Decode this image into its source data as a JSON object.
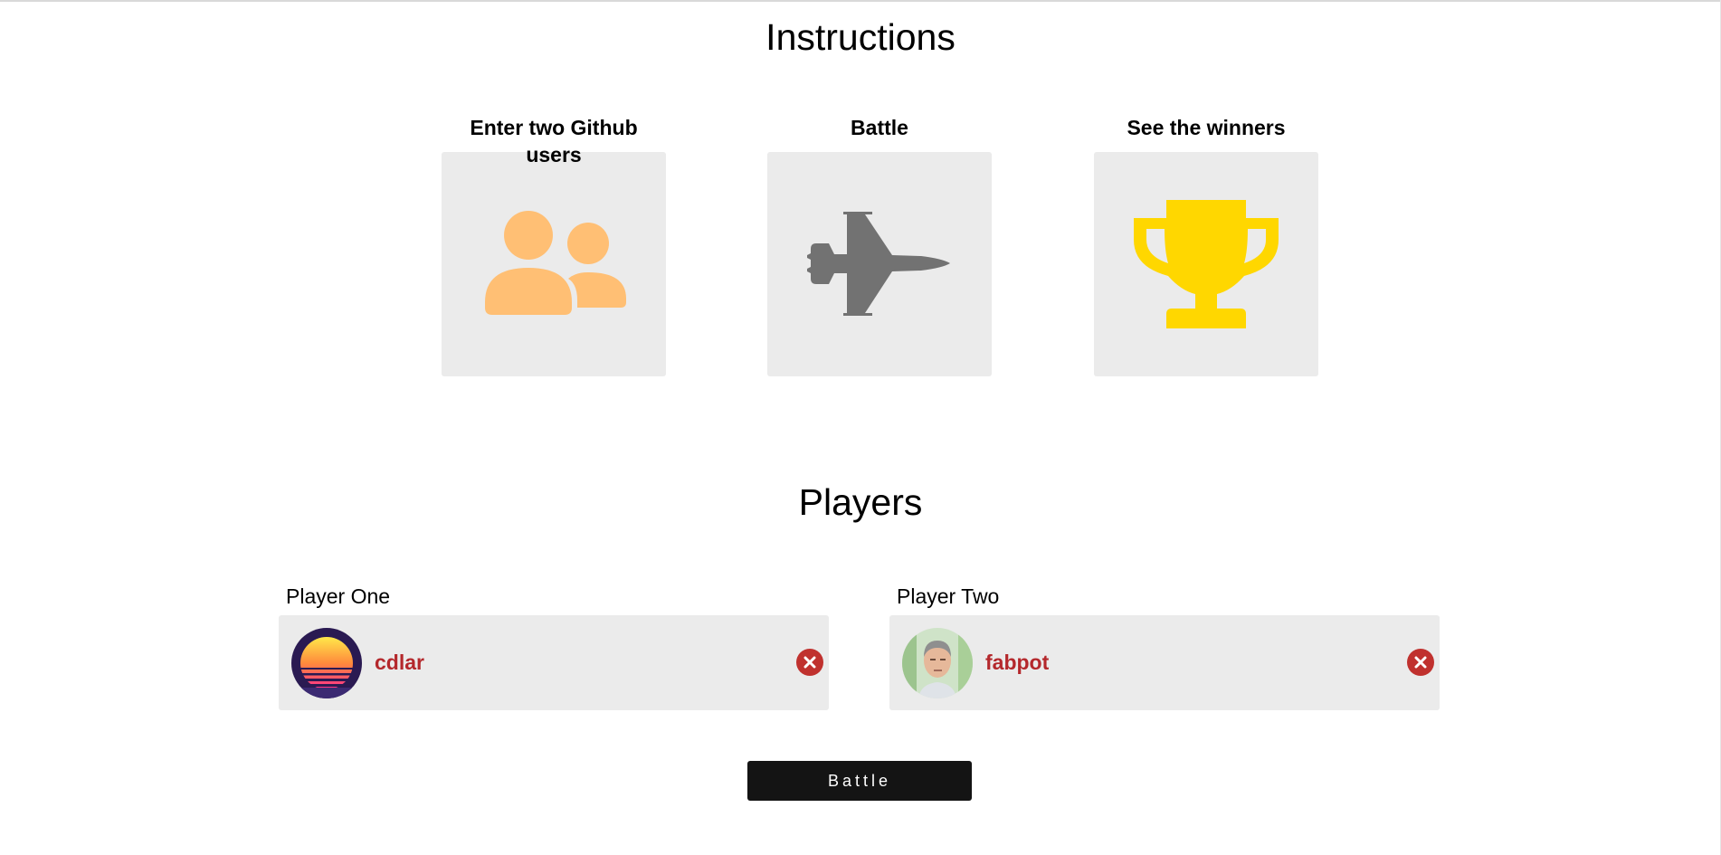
{
  "instructions": {
    "title": "Instructions",
    "steps": [
      {
        "label": "Enter two Github users",
        "icon": "users-icon",
        "color": "#ffbf74"
      },
      {
        "label": "Battle",
        "icon": "fighter-jet-icon",
        "color": "#727272"
      },
      {
        "label": "See the winners",
        "icon": "trophy-icon",
        "color": "#ffd700"
      }
    ]
  },
  "players": {
    "title": "Players",
    "player_one": {
      "heading": "Player One",
      "username": "cdlar"
    },
    "player_two": {
      "heading": "Player Two",
      "username": "fabpot"
    }
  },
  "battle_button": {
    "label": "Battle"
  },
  "colors": {
    "username": "#b4282c",
    "remove": "#c0312e",
    "card_background": "#ebebeb",
    "button_background": "#141414"
  }
}
